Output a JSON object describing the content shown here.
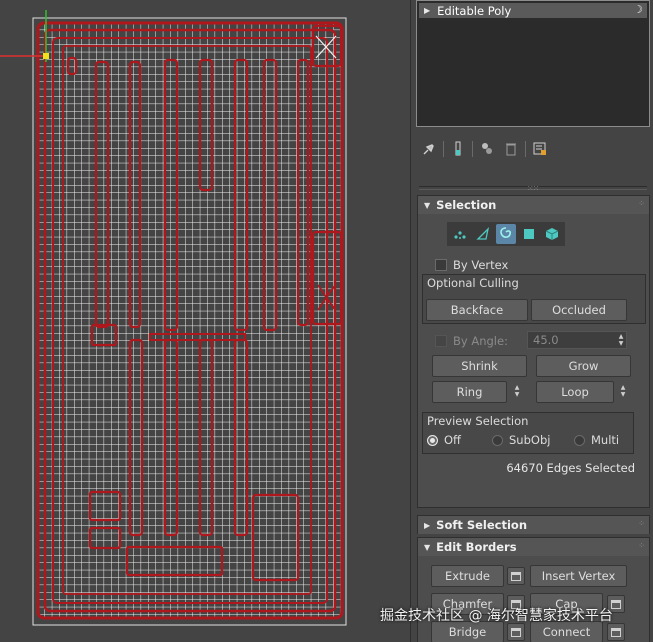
{
  "modifier_stack": {
    "item": "Editable Poly"
  },
  "toolbar": {
    "icons": [
      "pin-stack-icon",
      "show-end-result-icon",
      "make-unique-icon",
      "remove-modifier-icon",
      "configure-sets-icon"
    ]
  },
  "selection": {
    "title": "Selection",
    "modes": [
      "vertex-icon",
      "edge-icon",
      "border-icon",
      "polygon-icon",
      "element-icon"
    ],
    "active_mode": "border-icon",
    "by_vertex": "By Vertex",
    "optional_culling": "Optional Culling",
    "backface": "Backface",
    "occluded": "Occluded",
    "by_angle": "By Angle:",
    "angle_value": "45.0",
    "shrink": "Shrink",
    "grow": "Grow",
    "ring": "Ring",
    "loop": "Loop",
    "preview_selection": "Preview Selection",
    "preview_off": "Off",
    "preview_subobj": "SubObj",
    "preview_multi": "Multi",
    "status": "64670 Edges Selected"
  },
  "soft_selection": {
    "title": "Soft Selection"
  },
  "edit_borders": {
    "title": "Edit Borders",
    "extrude": "Extrude",
    "insert_vertex": "Insert Vertex",
    "chamfer": "Chamfer",
    "cap": "Cap",
    "bridge": "Bridge",
    "connect": "Connect"
  },
  "watermark": "掘金技术社区 @ 海尔智慧家技术平台",
  "colors": {
    "viewport_bg": "#444444",
    "wire": "#f2f2f2",
    "border_selected": "#b0171c",
    "active_mode": "#5b86a8",
    "axis_x": "#e03030",
    "axis_y": "#30c030"
  }
}
